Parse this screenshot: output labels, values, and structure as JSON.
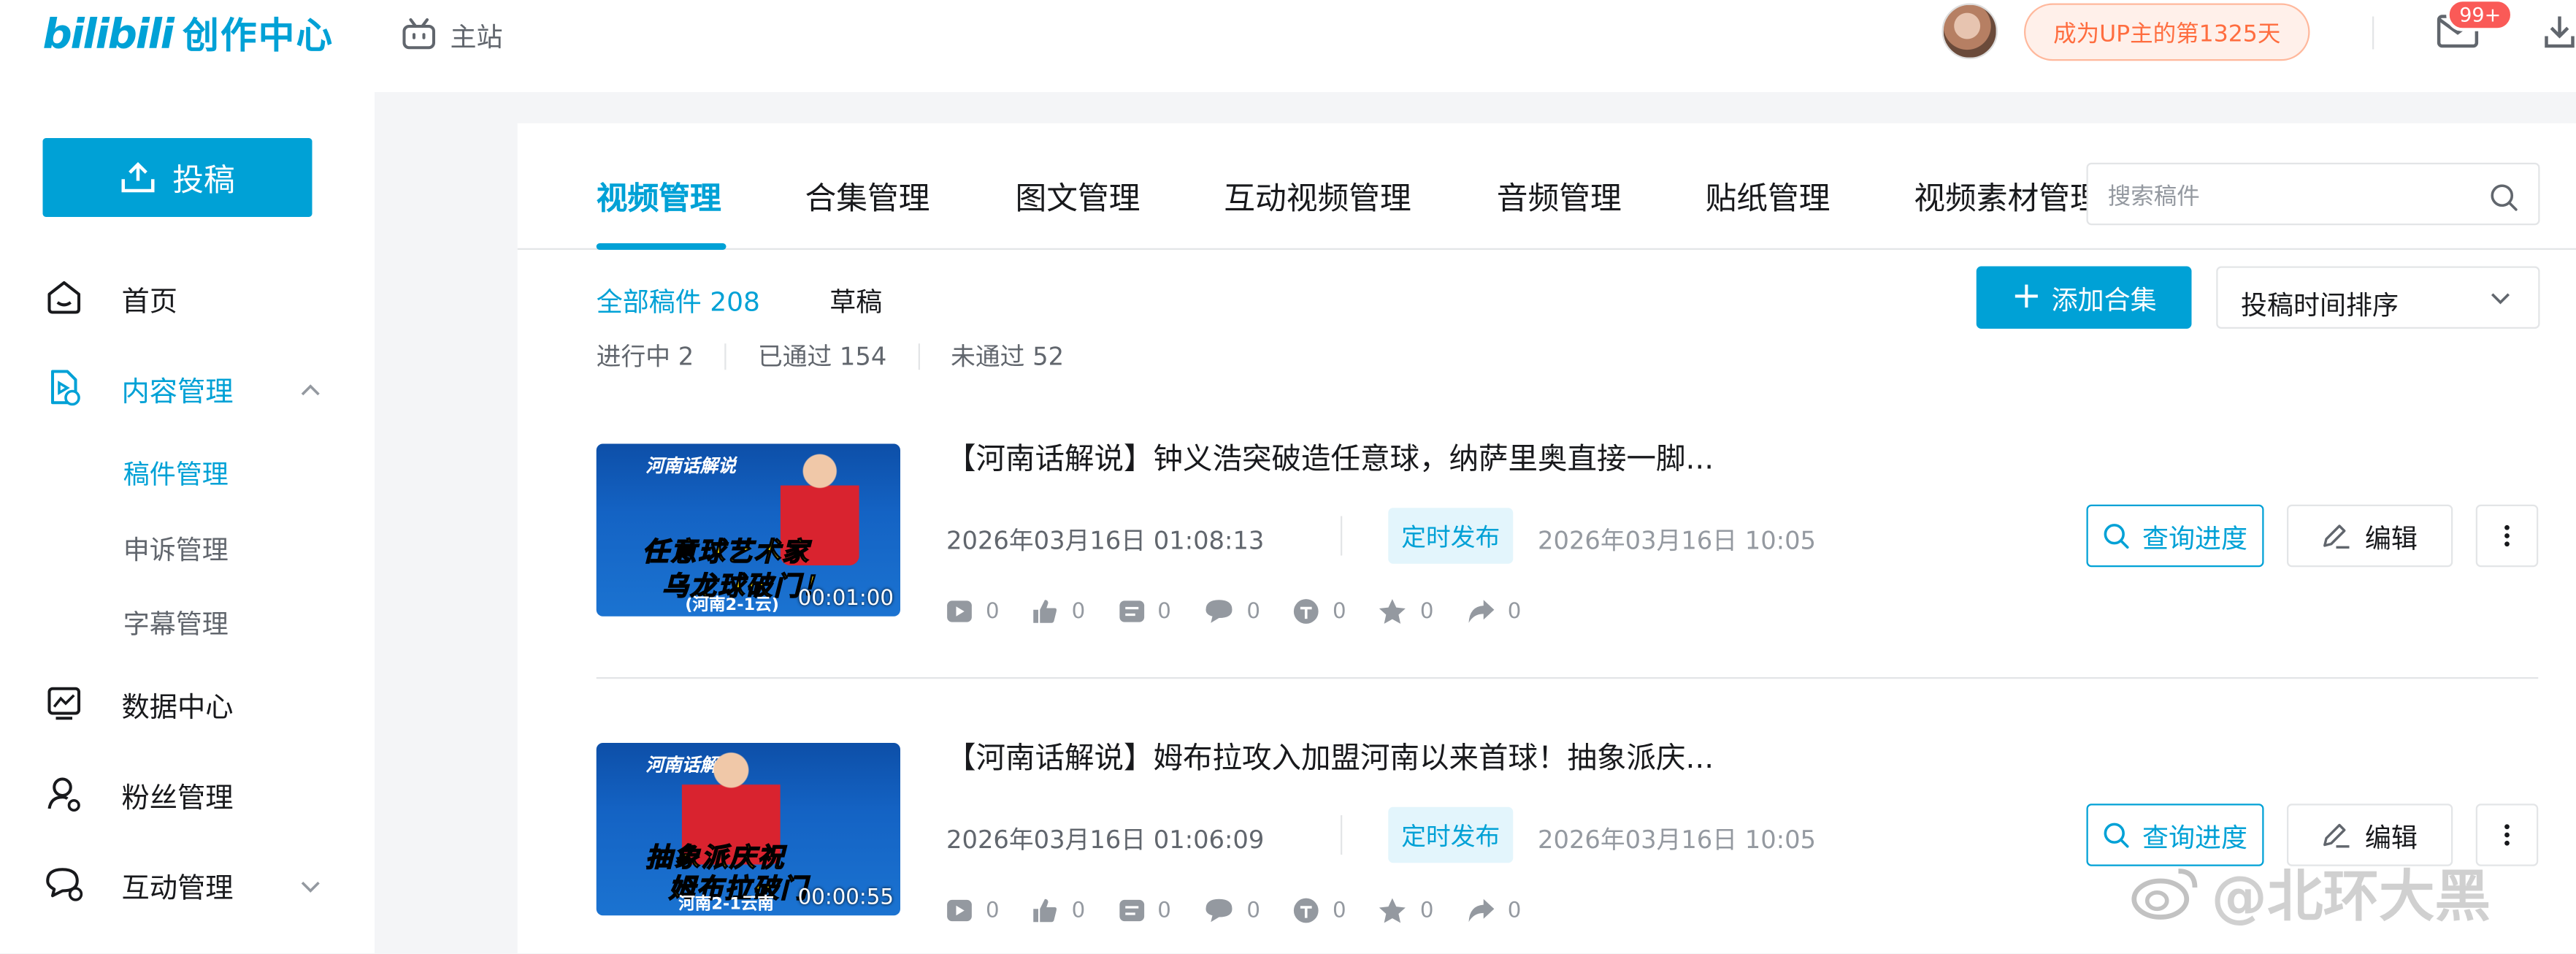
{
  "brand": {
    "logo": "bilibili",
    "name": "创作中心"
  },
  "header": {
    "main_site": "主站",
    "up_badge": "成为UP主的第1325天",
    "mail_badge": "99+"
  },
  "sidebar": {
    "upload": "投稿",
    "items": [
      {
        "label": "首页"
      },
      {
        "label": "内容管理"
      },
      {
        "label": "数据中心"
      },
      {
        "label": "粉丝管理"
      },
      {
        "label": "互动管理"
      }
    ],
    "sub_items": [
      {
        "label": "稿件管理"
      },
      {
        "label": "申诉管理"
      },
      {
        "label": "字幕管理"
      }
    ]
  },
  "tabs": [
    "视频管理",
    "合集管理",
    "图文管理",
    "互动视频管理",
    "音频管理",
    "贴纸管理",
    "视频素材管理"
  ],
  "search": {
    "placeholder": "搜索稿件"
  },
  "filters": {
    "all": "全部稿件 208",
    "draft": "草稿",
    "in_progress": "进行中 2",
    "passed": "已通过 154",
    "rejected": "未通过 52"
  },
  "actions": {
    "add_collection": "添加合集",
    "sort": "投稿时间排序"
  },
  "videos": [
    {
      "title": "【河南话解说】钟义浩突破造任意球，纳萨里奥直接一脚...",
      "thumb_header": "河南话解说",
      "thumb_line1": "任意球艺术家",
      "thumb_line2": "乌龙球破门！",
      "thumb_line3": "(河南2-1云)",
      "duration": "00:01:00",
      "submitted": "2026年03月16日 01:08:13",
      "status": "定时发布",
      "publish_at": "2026年03月16日 10:05",
      "stats": [
        "0",
        "0",
        "0",
        "0",
        "0",
        "0",
        "0"
      ],
      "btn_progress": "查询进度",
      "btn_edit": "编辑"
    },
    {
      "title": "【河南话解说】姆布拉攻入加盟河南以来首球！抽象派庆...",
      "thumb_header": "河南话解说",
      "thumb_line1": "抽象派庆祝",
      "thumb_line2": "姆布拉破门",
      "thumb_line3": "河南2-1云南",
      "duration": "00:00:55",
      "submitted": "2026年03月16日 01:06:09",
      "status": "定时发布",
      "publish_at": "2026年03月16日 10:05",
      "stats": [
        "0",
        "0",
        "0",
        "0",
        "0",
        "0",
        "0"
      ],
      "btn_progress": "查询进度",
      "btn_edit": "编辑"
    }
  ],
  "watermark": "@北环大黑",
  "colors": {
    "accent": "#00a1d6",
    "badge": "#fa5a57",
    "orange": "#ff6d3f"
  }
}
